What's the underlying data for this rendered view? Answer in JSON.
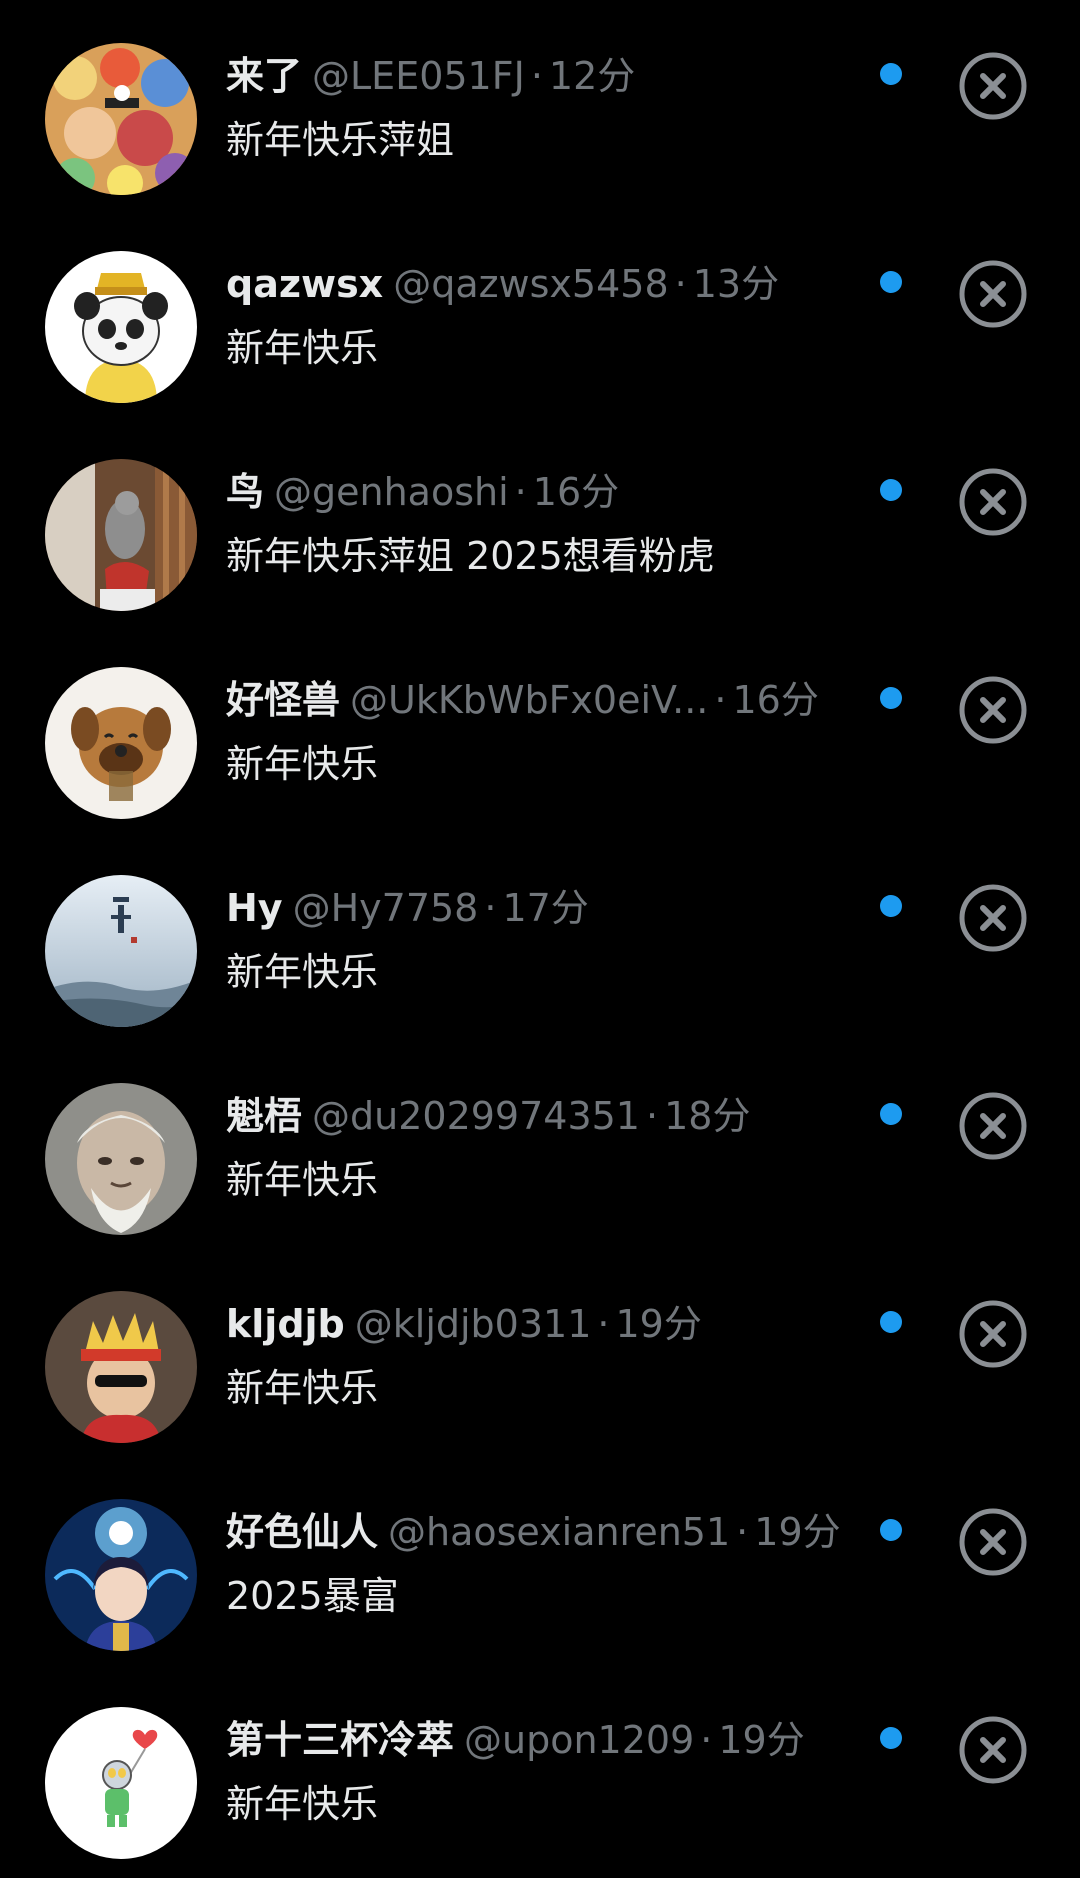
{
  "colors": {
    "background": "#000000",
    "primary_text": "#e7e9ea",
    "secondary_text": "#71767b",
    "unread_dot": "#1d9bf0",
    "dismiss_icon": "#8b8f94"
  },
  "notifications": [
    {
      "name": "来了",
      "handle": "@LEE051FJ",
      "separator": "·",
      "time": "12分",
      "message": "新年快乐萍姐",
      "avatar_icon": "anime-crowd-avatar",
      "unread": true,
      "dismiss_icon": "close-circle-icon"
    },
    {
      "name": "qazwsx",
      "handle": "@qazwsx5458",
      "separator": "·",
      "time": "13分",
      "message": "新年快乐",
      "avatar_icon": "panda-meme-avatar",
      "unread": true,
      "dismiss_icon": "close-circle-icon"
    },
    {
      "name": "鸟",
      "handle": "@genhaoshi",
      "separator": "·",
      "time": "16分",
      "message": "新年快乐萍姐 2025想看粉虎",
      "avatar_icon": "parrot-avatar",
      "unread": true,
      "dismiss_icon": "close-circle-icon"
    },
    {
      "name": "好怪兽",
      "handle": "@UkKbWbFx0eiV...",
      "separator": "·",
      "time": "16分",
      "message": "新年快乐",
      "avatar_icon": "puppy-avatar",
      "unread": true,
      "dismiss_icon": "close-circle-icon"
    },
    {
      "name": "Hy",
      "handle": "@Hy7758",
      "separator": "·",
      "time": "17分",
      "message": "新年快乐",
      "avatar_icon": "winter-landscape-avatar",
      "unread": true,
      "dismiss_icon": "close-circle-icon"
    },
    {
      "name": "魁梧",
      "handle": "@du2029974351",
      "separator": "·",
      "time": "18分",
      "message": "新年快乐",
      "avatar_icon": "old-man-avatar",
      "unread": true,
      "dismiss_icon": "close-circle-icon"
    },
    {
      "name": "kljdjb",
      "handle": "@kljdjb0311",
      "separator": "·",
      "time": "19分",
      "message": "新年快乐",
      "avatar_icon": "child-crown-avatar",
      "unread": true,
      "dismiss_icon": "close-circle-icon"
    },
    {
      "name": "好色仙人",
      "handle": "@haosexianren51",
      "separator": "·",
      "time": "19分",
      "message": "2025暴富",
      "avatar_icon": "anime-girl-avatar",
      "unread": true,
      "dismiss_icon": "close-circle-icon"
    },
    {
      "name": "第十三杯冷萃",
      "handle": "@upon1209",
      "separator": "·",
      "time": "19分",
      "message": "新年快乐",
      "avatar_icon": "cartoon-balloon-avatar",
      "unread": true,
      "dismiss_icon": "close-circle-icon"
    }
  ]
}
